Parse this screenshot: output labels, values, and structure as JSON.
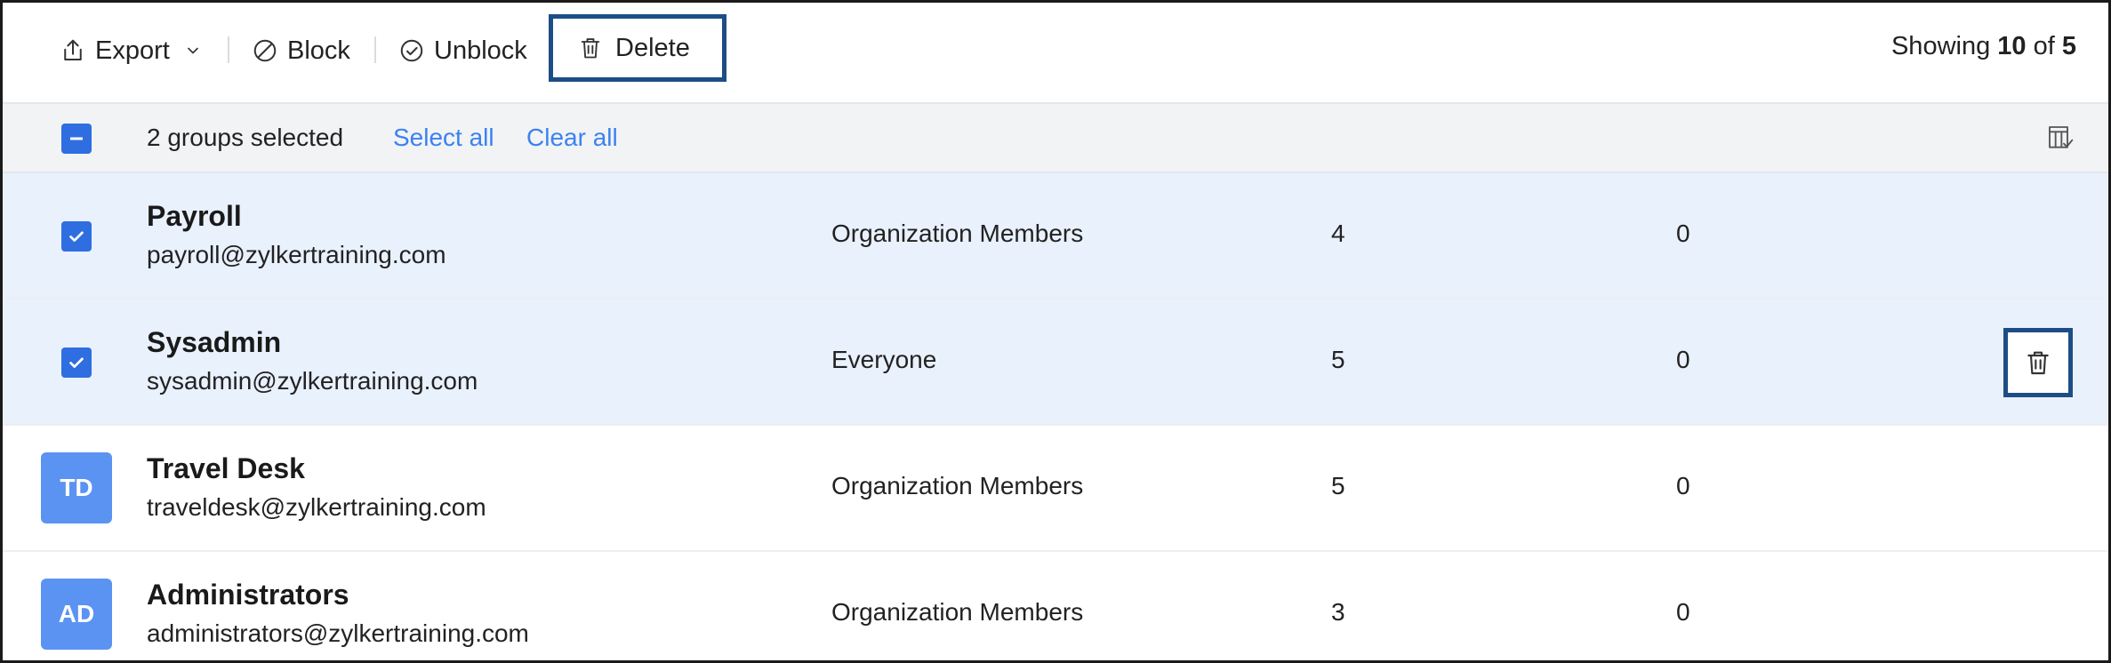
{
  "toolbar": {
    "export_label": "Export",
    "block_label": "Block",
    "unblock_label": "Unblock",
    "delete_label": "Delete",
    "showing_prefix": "Showing",
    "showing_count": "10",
    "showing_of": "of",
    "showing_total": "5"
  },
  "selection": {
    "count_text": "2 groups selected",
    "select_all": "Select all",
    "clear_all": "Clear all"
  },
  "groups": [
    {
      "name": "Payroll",
      "email": "payroll@zylkertraining.com",
      "type": "Organization Members",
      "members": "4",
      "other": "0",
      "selected": true,
      "initials": ""
    },
    {
      "name": "Sysadmin",
      "email": "sysadmin@zylkertraining.com",
      "type": "Everyone",
      "members": "5",
      "other": "0",
      "selected": true,
      "initials": ""
    },
    {
      "name": "Travel Desk",
      "email": "traveldesk@zylkertraining.com",
      "type": "Organization Members",
      "members": "5",
      "other": "0",
      "selected": false,
      "initials": "TD"
    },
    {
      "name": "Administrators",
      "email": "administrators@zylkertraining.com",
      "type": "Organization Members",
      "members": "3",
      "other": "0",
      "selected": false,
      "initials": "AD"
    }
  ],
  "colors": {
    "accent": "#2e6ee0",
    "link": "#3b82f0",
    "highlight_border": "#1d4d86",
    "selected_row": "#e9f1fd",
    "avatar": "#5b93f3"
  }
}
